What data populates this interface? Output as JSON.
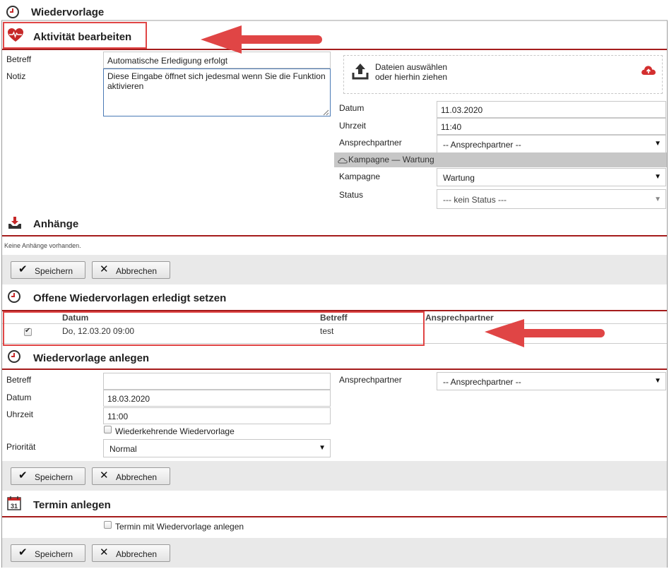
{
  "page": {
    "title": "Wiedervorlage"
  },
  "activity": {
    "title": "Aktivität bearbeiten",
    "subject_label": "Betreff",
    "subject_value": "Automatische Erledigung erfolgt",
    "note_label": "Notiz",
    "note_value": "Diese Eingabe öffnet sich jedesmal wenn Sie die Funktion aktivieren",
    "upload_line1": "Dateien auswählen",
    "upload_line2": "oder hierhin ziehen",
    "date_label": "Datum",
    "date_value": "11.03.2020",
    "time_label": "Uhrzeit",
    "time_value": "11:40",
    "contact_label": "Ansprechpartner",
    "contact_value": "-- Ansprechpartner --",
    "campaign_bar": "Kampagne — Wartung",
    "campaign_label": "Kampagne",
    "campaign_value": "Wartung",
    "status_label": "Status",
    "status_value": "--- kein Status ---"
  },
  "attachments": {
    "title": "Anhänge",
    "empty_text": "Keine Anhänge vorhanden."
  },
  "buttons": {
    "save": "Speichern",
    "cancel": "Abbrechen"
  },
  "open_followups": {
    "title": "Offene Wiedervorlagen erledigt setzen",
    "columns": [
      "Datum",
      "Betreff",
      "Ansprechpartner"
    ],
    "rows": [
      {
        "checked": true,
        "date": "Do, 12.03.20 09:00",
        "subject": "test",
        "contact": ""
      }
    ]
  },
  "new_followup": {
    "title": "Wiedervorlage anlegen",
    "subject_label": "Betreff",
    "subject_value": "",
    "date_label": "Datum",
    "date_value": "18.03.2020",
    "time_label": "Uhrzeit",
    "time_value": "11:00",
    "recurring_label": "Wiederkehrende Wiedervorlage",
    "priority_label": "Priorität",
    "priority_value": "Normal",
    "contact_label": "Ansprechpartner",
    "contact_value": "-- Ansprechpartner --"
  },
  "appointment": {
    "title": "Termin anlegen",
    "with_followup_label": "Termin mit Wiedervorlage anlegen",
    "calendar_day": "31"
  },
  "colors": {
    "accent": "#a51c1c",
    "annotation": "#e04545",
    "brand_icon": "#c62828"
  }
}
